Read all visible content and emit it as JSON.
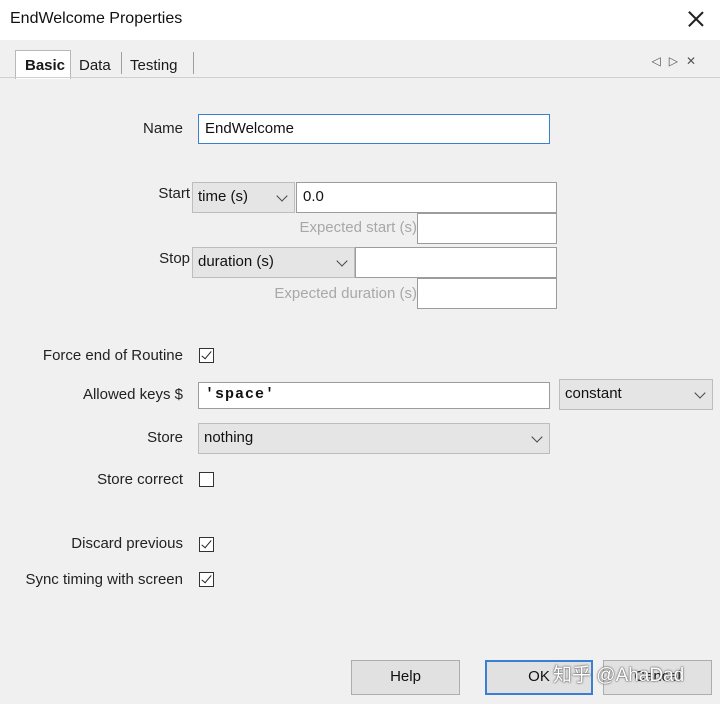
{
  "window": {
    "title": "EndWelcome Properties"
  },
  "tabs": [
    {
      "label": "Basic"
    },
    {
      "label": "Data"
    },
    {
      "label": "Testing"
    }
  ],
  "tab_nav": {
    "prev": "◁",
    "next": "▷",
    "close": "✕"
  },
  "fields": {
    "name_label": "Name",
    "name_value": "EndWelcome",
    "start_label": "Start",
    "start_type": "time (s)",
    "start_value": "0.0",
    "expected_start_label": "Expected start (s)",
    "stop_label": "Stop",
    "stop_type": "duration (s)",
    "stop_value": "",
    "expected_duration_label": "Expected duration (s)",
    "force_end_label": "Force end of Routine",
    "force_end_checked": true,
    "allowed_keys_label": "Allowed keys $",
    "allowed_keys_value": "'space'",
    "allowed_keys_mode": "constant",
    "store_label": "Store",
    "store_value": "nothing",
    "store_correct_label": "Store correct",
    "store_correct_checked": false,
    "discard_previous_label": "Discard previous",
    "discard_previous_checked": true,
    "sync_timing_label": "Sync timing with screen",
    "sync_timing_checked": true
  },
  "buttons": {
    "help": "Help",
    "ok": "OK",
    "cancel": "Cancel"
  },
  "watermark": "知乎 @AhaDad"
}
